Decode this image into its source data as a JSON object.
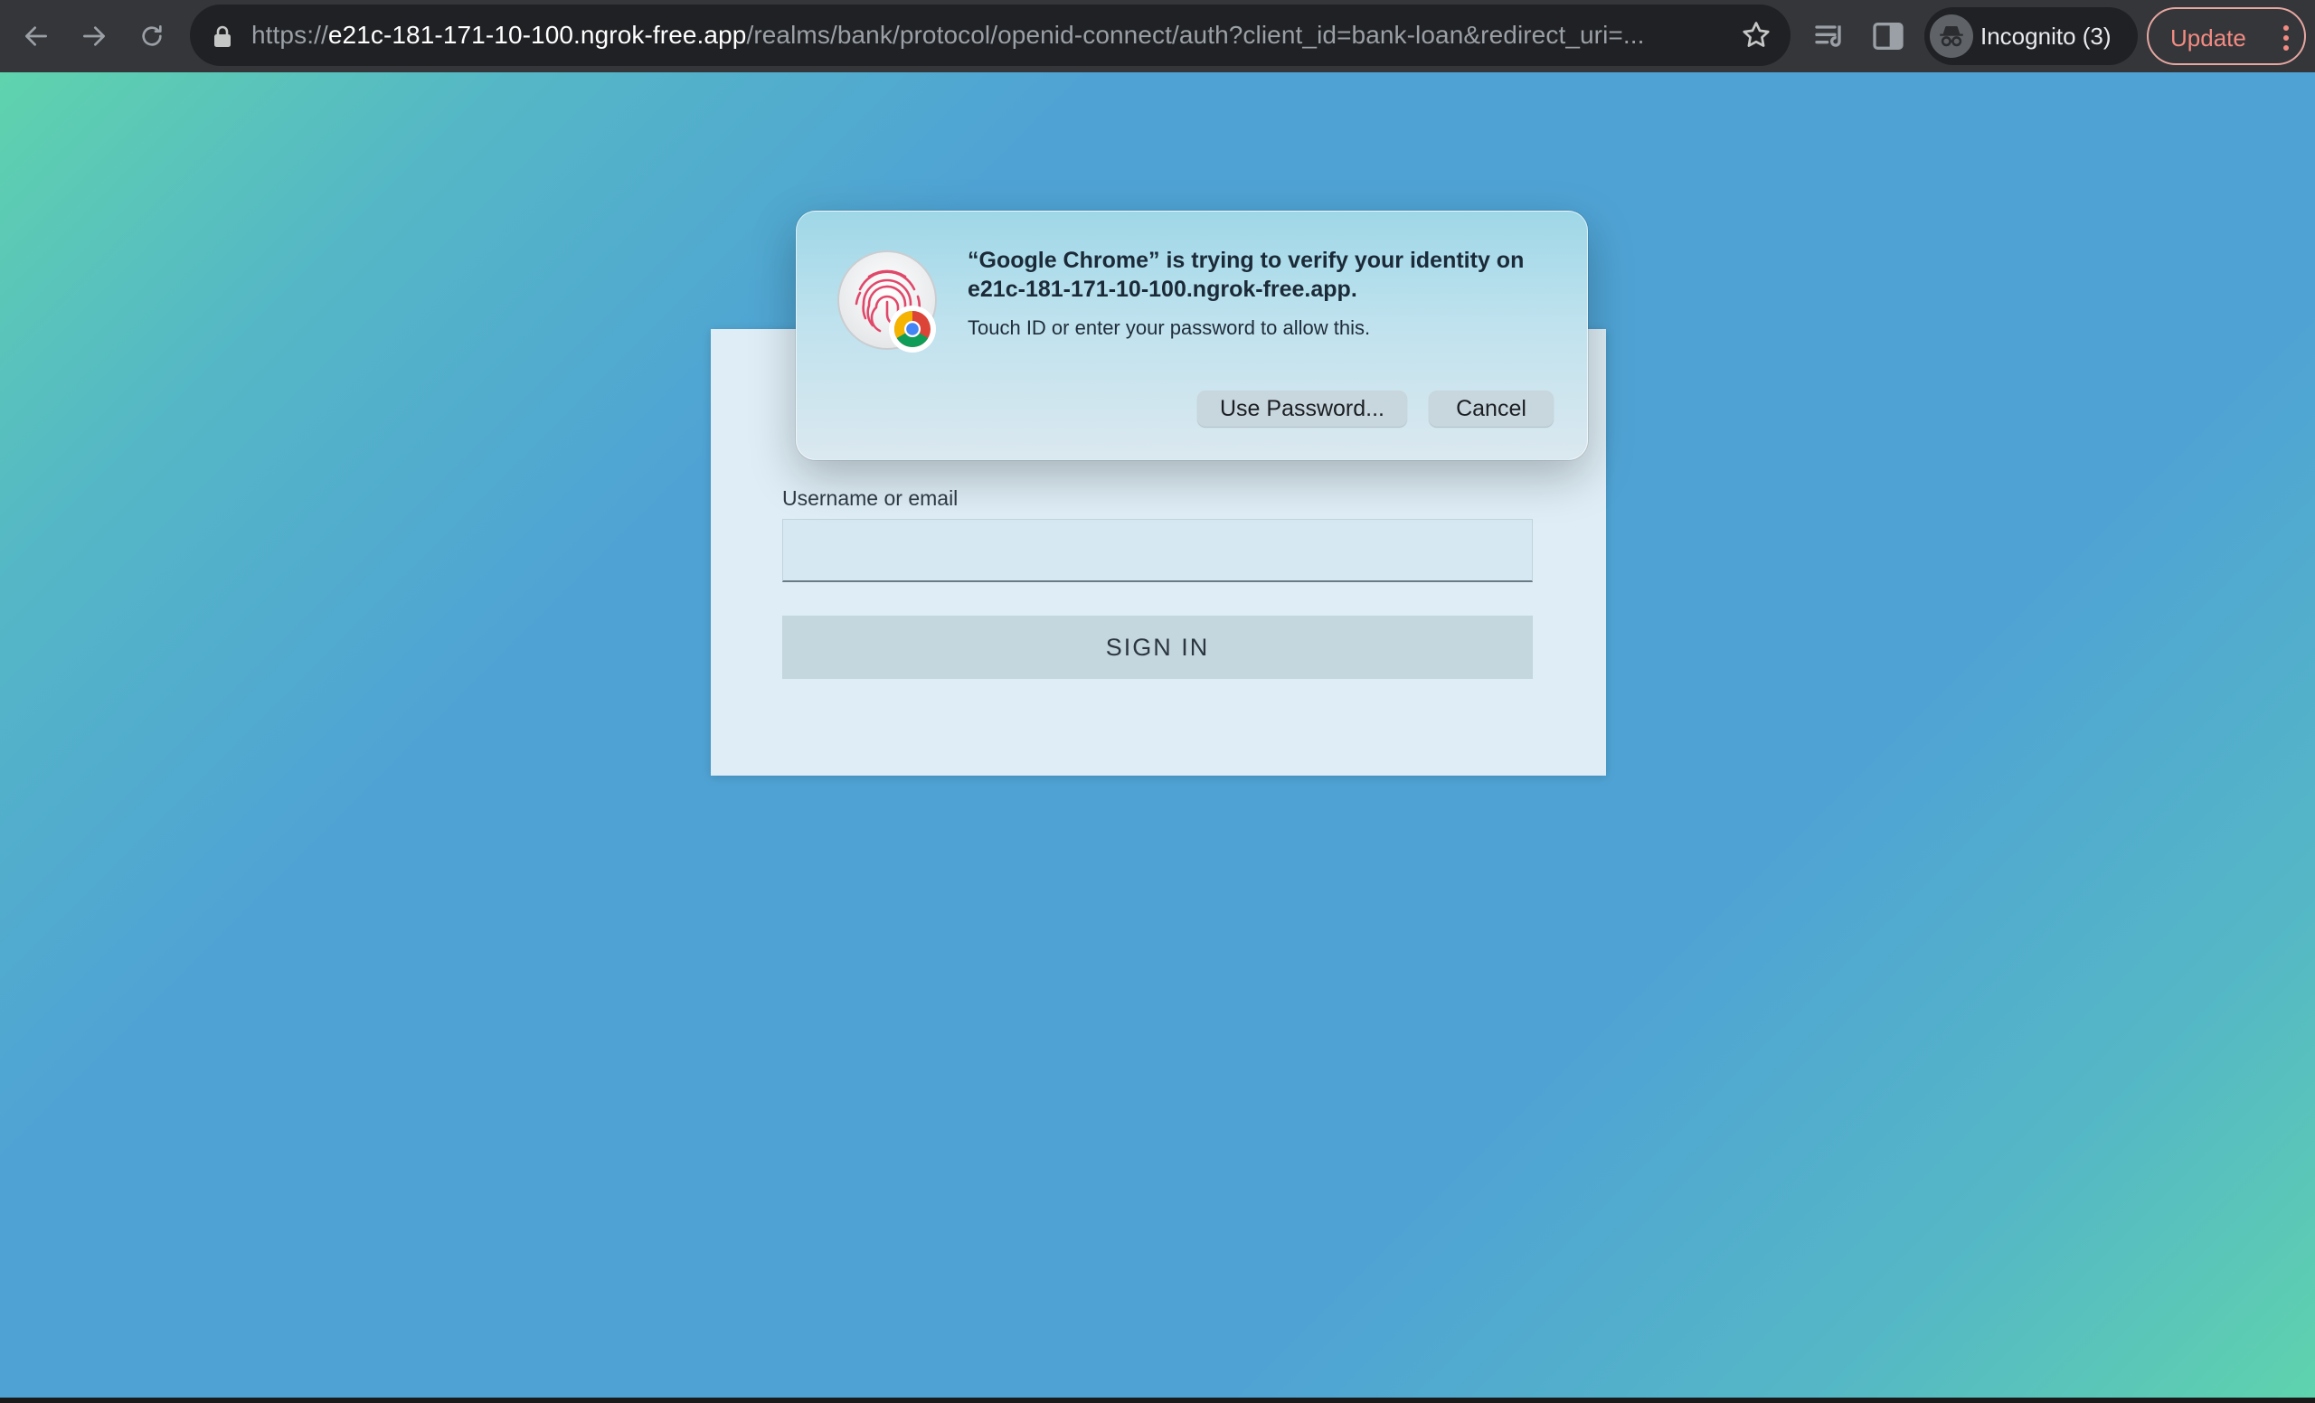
{
  "browser": {
    "url_scheme": "https://",
    "url_host": "e21c-181-171-10-100.ngrok-free.app",
    "url_path": "/realms/bank/protocol/openid-connect/auth?client_id=bank-loan&redirect_uri=...",
    "incognito_label": "Incognito (3)",
    "update_label": "Update",
    "icons": {
      "back": "arrow-left-icon",
      "forward": "arrow-right-icon",
      "reload": "reload-icon",
      "lock": "lock-icon",
      "bookmark": "star-icon",
      "media": "media-queue-icon",
      "side_panel": "side-panel-icon",
      "incognito": "incognito-icon",
      "menu": "kebab-menu-icon"
    }
  },
  "login": {
    "username_label": "Username or email",
    "username_value": "",
    "signin_label": "SIGN IN"
  },
  "dialog": {
    "title": "“Google Chrome” is trying to verify your identity on e21c-181-171-10-100.ngrok-free.app.",
    "message": "Touch ID or enter your password to allow this.",
    "use_password_label": "Use Password...",
    "cancel_label": "Cancel",
    "icon": "touch-id-fingerprint-icon",
    "badge_icon": "chrome-logo-icon"
  },
  "colors": {
    "toolbar": "#35363a",
    "omnibox": "#202124",
    "page_gradient_corner": "#5fd3ad",
    "page_gradient_center": "#4fa3d4",
    "card": "#deedf6",
    "update_accent": "#f28b82",
    "fingerprint": "#e0486a"
  }
}
